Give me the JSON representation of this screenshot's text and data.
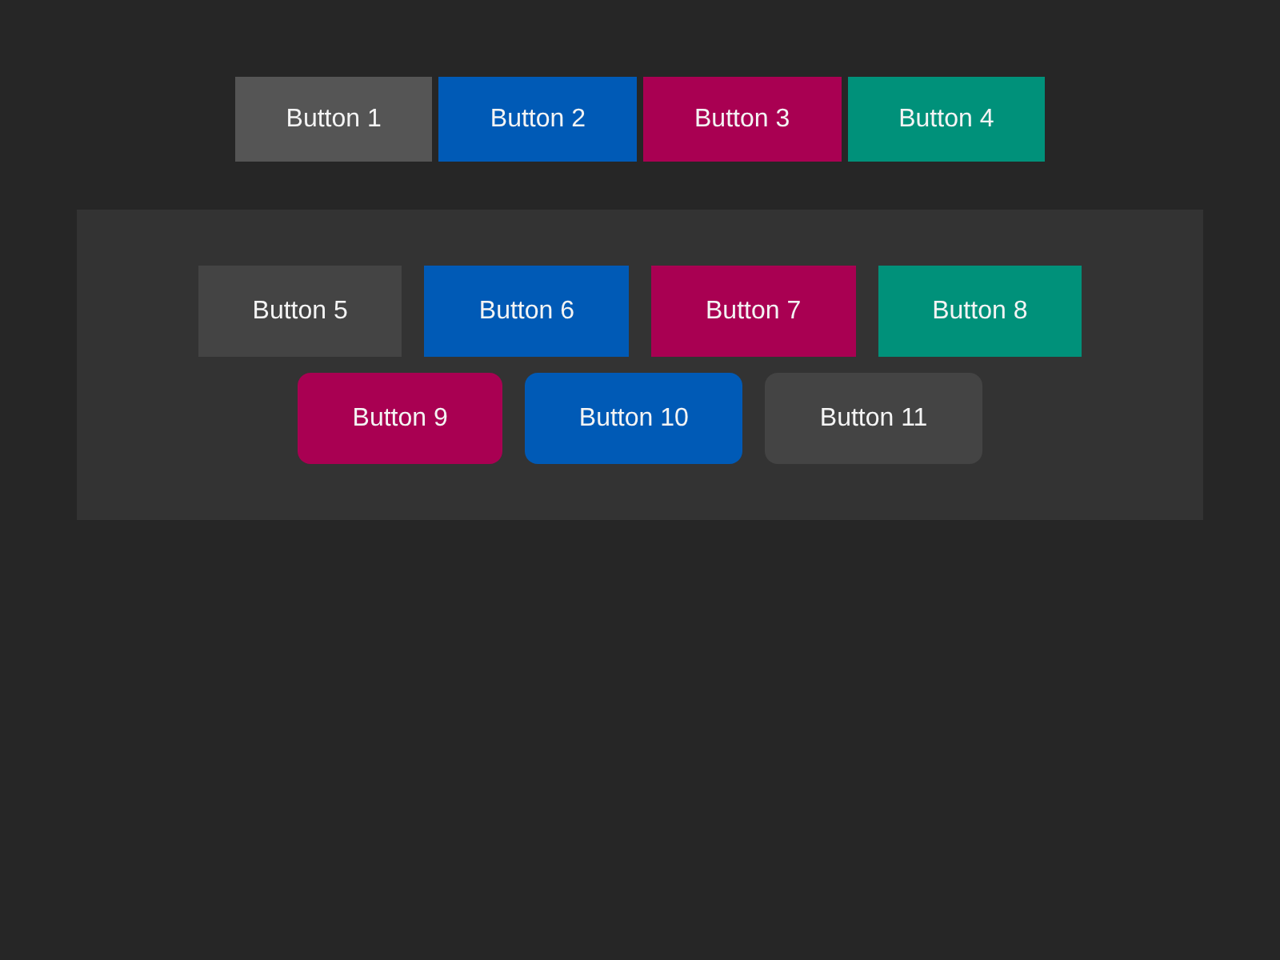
{
  "top_row": {
    "buttons": [
      {
        "label": "Button 1",
        "color": "#555555",
        "kind": "square"
      },
      {
        "label": "Button 2",
        "color": "#005ab6",
        "kind": "square"
      },
      {
        "label": "Button 3",
        "color": "#a90052",
        "kind": "square"
      },
      {
        "label": "Button 4",
        "color": "#00917a",
        "kind": "square"
      }
    ]
  },
  "panel": {
    "rows": [
      {
        "buttons": [
          {
            "label": "Button 5",
            "color": "#444444",
            "kind": "square"
          },
          {
            "label": "Button 6",
            "color": "#005ab6",
            "kind": "square"
          },
          {
            "label": "Button 7",
            "color": "#a90052",
            "kind": "square"
          },
          {
            "label": "Button 8",
            "color": "#00917a",
            "kind": "square"
          }
        ]
      },
      {
        "buttons": [
          {
            "label": "Button 9",
            "color": "#a90052",
            "kind": "rounded"
          },
          {
            "label": "Button 10",
            "color": "#005ab6",
            "kind": "rounded"
          },
          {
            "label": "Button 11",
            "color": "#444444",
            "kind": "rounded"
          }
        ]
      }
    ]
  }
}
